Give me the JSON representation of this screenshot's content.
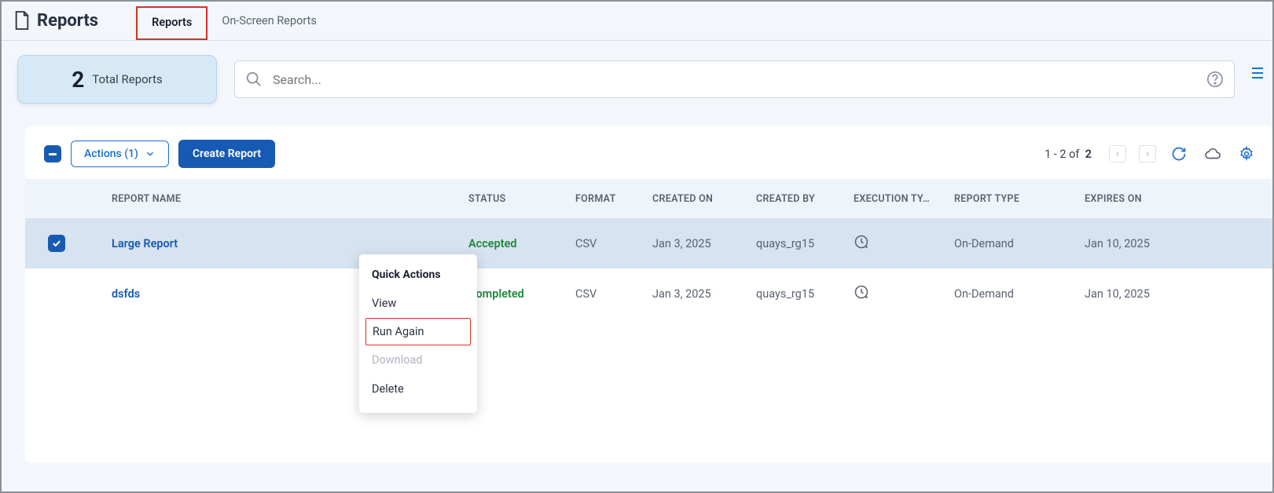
{
  "header": {
    "title": "Reports",
    "tabs": [
      {
        "label": "Reports",
        "active": true
      },
      {
        "label": "On-Screen Reports",
        "active": false
      }
    ]
  },
  "summary": {
    "count": "2",
    "label": "Total Reports"
  },
  "search": {
    "placeholder": "Search..."
  },
  "controls": {
    "actions_label": "Actions (1)",
    "create_label": "Create Report",
    "pagination_range": "1 - 2 of",
    "pagination_total": "2"
  },
  "columns": {
    "name": "REPORT NAME",
    "status": "STATUS",
    "format": "FORMAT",
    "created_on": "CREATED ON",
    "created_by": "CREATED BY",
    "exec_type": "EXECUTION TY…",
    "report_type": "REPORT TYPE",
    "expires_on": "EXPIRES ON"
  },
  "rows": [
    {
      "selected": true,
      "name": "Large Report",
      "status": "Accepted",
      "format": "CSV",
      "created_on": "Jan 3, 2025",
      "created_by": "quays_rg15",
      "report_type": "On-Demand",
      "expires_on": "Jan 10, 2025"
    },
    {
      "selected": false,
      "name": "dsfds",
      "status": "Completed",
      "format": "CSV",
      "created_on": "Jan 3, 2025",
      "created_by": "quays_rg15",
      "report_type": "On-Demand",
      "expires_on": "Jan 10, 2025"
    }
  ],
  "context_menu": {
    "title": "Quick Actions",
    "items": {
      "view": "View",
      "run_again": "Run Again",
      "download": "Download",
      "delete": "Delete"
    }
  }
}
